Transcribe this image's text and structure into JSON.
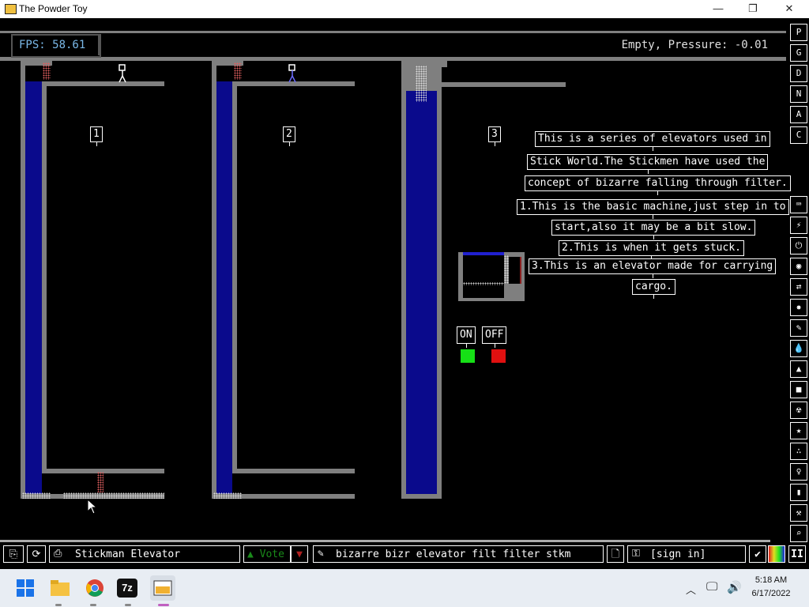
{
  "window": {
    "title": "The Powder Toy",
    "minimize": "—",
    "maximize": "❐",
    "close": "✕"
  },
  "hud": {
    "fps": "FPS: 58.61",
    "status": "Empty, Pressure: -0.01"
  },
  "signs": {
    "one": "1",
    "two": "2",
    "three": "3",
    "desc": [
      "This is a series of elevators used in",
      "Stick World.The Stickmen have used the",
      "concept of bizarre falling through filter.",
      "1.This is the basic machine,just step in to",
      "start,also it may be a bit slow.",
      "2.This is when it gets stuck.",
      "3.This is an elevator made for carrying",
      "cargo."
    ],
    "on": "ON",
    "off": "OFF"
  },
  "colors": {
    "on_switch": "#16e016",
    "off_switch": "#e01010",
    "water": "#0a0a8c",
    "wall": "#7f7f7f"
  },
  "right_menu": {
    "top_buttons": [
      "P",
      "G",
      "D",
      "N",
      "A",
      "C"
    ],
    "categories": [
      "keyboard-icon",
      "plug-icon",
      "power-icon",
      "sensor-icon",
      "force-icon",
      "explosive-icon",
      "pen-icon",
      "liquid-icon",
      "powder-icon",
      "solid-icon",
      "radioactive-icon",
      "special-icon",
      "particles-icon",
      "life-icon",
      "save-icon",
      "tools-icon",
      "search-icon"
    ]
  },
  "bottom_bar": {
    "save_title": "Stickman Elevator",
    "vote": "Vote",
    "tags": "bizarre bizr elevator filt filter stkm",
    "sign_in": "[sign in]",
    "pause": "II"
  },
  "taskbar": {
    "time": "5:18 AM",
    "date": "6/17/2022",
    "apps": [
      "windows-start-icon",
      "file-explorer-icon",
      "chrome-icon",
      "7zip-icon",
      "powder-toy-icon"
    ],
    "seven_zip": "7z"
  }
}
